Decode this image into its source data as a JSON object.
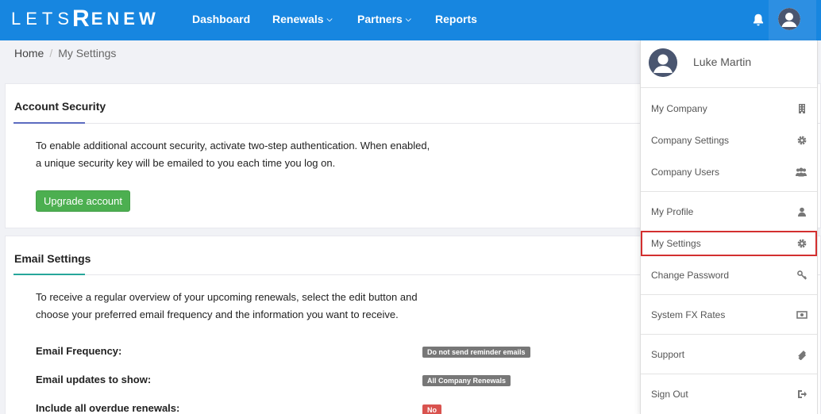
{
  "brand": {
    "logo_part1": "LETS",
    "logo_part2": "R",
    "logo_part3": "ENEW"
  },
  "nav": {
    "items": [
      {
        "label": "Dashboard",
        "has_menu": false
      },
      {
        "label": "Renewals",
        "has_menu": true
      },
      {
        "label": "Partners",
        "has_menu": true
      },
      {
        "label": "Reports",
        "has_menu": false
      }
    ]
  },
  "breadcrumb": {
    "home": "Home",
    "separator": "/",
    "current": "My Settings"
  },
  "account_security": {
    "title": "Account Security",
    "text_line1": "To enable additional account security, activate two-step authentication. When enabled,",
    "text_line2": "a unique security key will be emailed to you each time you log on.",
    "button_label": "Upgrade account"
  },
  "email_settings": {
    "title": "Email Settings",
    "text_line1": "To receive a regular overview of your upcoming renewals, select the edit button and",
    "text_line2": "choose your preferred email frequency and the information you want to receive.",
    "rows": [
      {
        "label": "Email Frequency:",
        "badge": "Do not send reminder emails",
        "badge_color": "#777777"
      },
      {
        "label": "Email updates to show:",
        "badge": "All Company Renewals",
        "badge_color": "#777777"
      },
      {
        "label": "Include all overdue renewals:",
        "badge": "No",
        "badge_color": "#d9534f"
      }
    ]
  },
  "user_menu": {
    "user_name": "Luke Martin",
    "items": [
      {
        "label": "My Company",
        "icon": "building-icon"
      },
      {
        "label": "Company Settings",
        "icon": "gear-icon"
      },
      {
        "label": "Company Users",
        "icon": "users-icon"
      },
      {
        "label": "My Profile",
        "icon": "user-icon"
      },
      {
        "label": "My Settings",
        "icon": "gear-icon",
        "active": true
      },
      {
        "label": "Change Password",
        "icon": "key-icon"
      },
      {
        "label": "System FX Rates",
        "icon": "money-icon"
      },
      {
        "label": "Support",
        "icon": "ticket-icon"
      },
      {
        "label": "Sign Out",
        "icon": "sign-out-icon"
      }
    ]
  },
  "colors": {
    "navbar": "#1786e0",
    "success": "#4caf50",
    "danger": "#d9534f",
    "badge_gray": "#777777",
    "highlight_border": "#d32f2f"
  }
}
